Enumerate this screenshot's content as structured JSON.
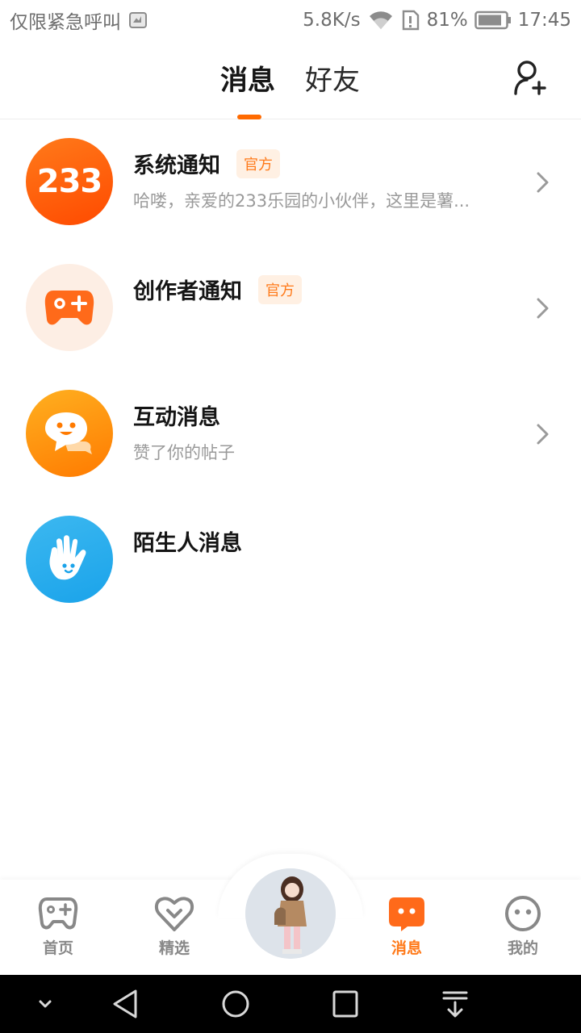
{
  "status_bar": {
    "carrier_text": "仅限紧急呼叫",
    "network_speed": "5.8K/s",
    "battery_percent": "81%",
    "time": "17:45"
  },
  "header": {
    "tabs": [
      {
        "label": "消息",
        "active": true
      },
      {
        "label": "好友",
        "active": false
      }
    ],
    "add_friend_icon": "person-add-icon"
  },
  "messages": [
    {
      "title": "系统通知",
      "badge": "官方",
      "subtitle": "哈喽，亲爱的233乐园的小伙伴，这里是薯...",
      "avatar_text": "233",
      "has_arrow": true
    },
    {
      "title": "创作者通知",
      "badge": "官方",
      "subtitle": "",
      "has_arrow": true
    },
    {
      "title": "互动消息",
      "subtitle": "赞了你的帖子",
      "has_arrow": true
    },
    {
      "title": "陌生人消息",
      "subtitle": "",
      "has_arrow": false
    }
  ],
  "bottom_nav": {
    "items": [
      {
        "label": "首页",
        "icon": "gamepad-icon"
      },
      {
        "label": "精选",
        "icon": "heart-chevron-icon"
      },
      {
        "label": "消息",
        "icon": "chat-bubble-icon",
        "active": true
      },
      {
        "label": "我的",
        "icon": "smile-face-icon"
      }
    ]
  },
  "colors": {
    "accent": "#ff7a1a",
    "badge_bg": "#fff0e3",
    "subtitle_gray": "#9a9a9a",
    "stranger_blue": "#1aa3ea"
  }
}
